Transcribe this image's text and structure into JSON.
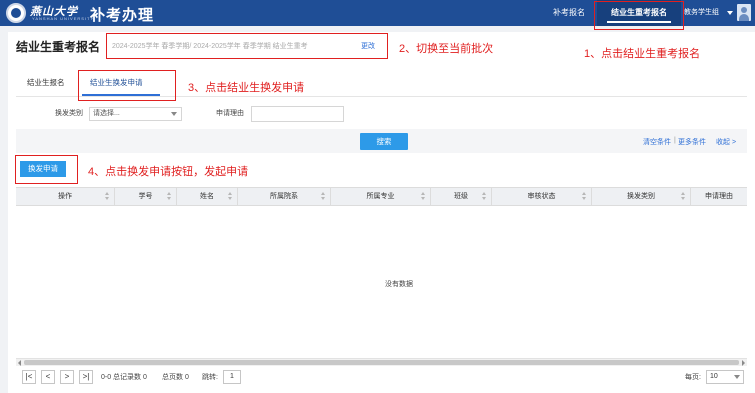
{
  "header": {
    "logo_text": "燕山大学",
    "logo_subtext": "YANSHAN UNIVERSITY",
    "app_title": "补考办理",
    "nav": [
      "补考报名",
      "结业生重考报名"
    ],
    "user": "教务学生组"
  },
  "page": {
    "title": "结业生重考报名",
    "batch_value": "2024-2025学年 春季学期/ 2024-2025学年 春季学期 结业生重考",
    "change_label": "更改"
  },
  "tabs": [
    "结业生报名",
    "结业生换发申请"
  ],
  "filters": {
    "type_label": "换发类别",
    "type_value": "请选择...",
    "reason_label": "申请理由",
    "reason_value": "",
    "search_label": "搜索",
    "clear_label": "清空条件",
    "more_label": "更多条件",
    "collapse_label": "收起 >"
  },
  "actions": {
    "apply_label": "换发申请"
  },
  "table": {
    "columns": [
      "操作",
      "学号",
      "姓名",
      "所属院系",
      "所属专业",
      "班级",
      "审核状态",
      "换发类别",
      "申请理由"
    ],
    "empty_text": "没有数据"
  },
  "pagination": {
    "first": "|<",
    "prev": "<",
    "next": ">",
    "last": ">|",
    "range": "0-0 总记录数 0",
    "total_pages": "总页数 0",
    "goto_label": "跳转:",
    "page_input": "1",
    "page_size_label": "每页:",
    "page_size": "10"
  },
  "annotations": {
    "step1": "1、点击结业生重考报名",
    "step2": "2、切换至当前批次",
    "step3": "3、点击结业生换发申请",
    "step4": "4、点击换发申请按钮，发起申请"
  },
  "colors": {
    "header_bg": "#1f4e96",
    "primary_button": "#2d9ae8",
    "annotation": "#e02020"
  }
}
